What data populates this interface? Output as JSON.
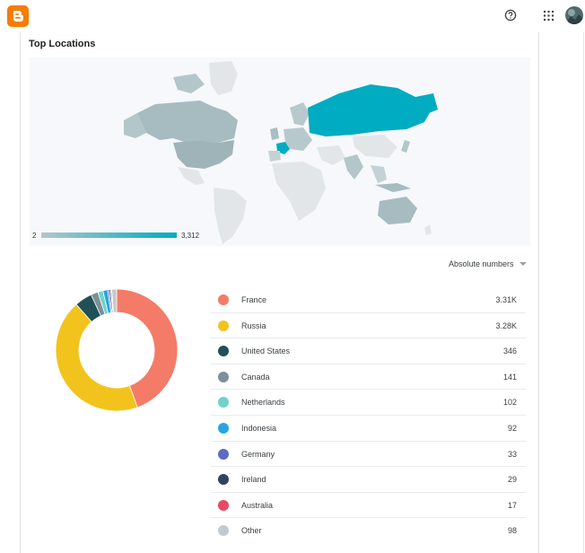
{
  "header": {
    "logo_icon": "blogger-logo-icon",
    "help_icon": "help-circle-icon",
    "apps_icon": "apps-grid-icon",
    "avatar": "user-avatar"
  },
  "section": {
    "title": "Top Locations"
  },
  "map": {
    "legend_min": "2",
    "legend_max": "3,312",
    "color_low": "#b3c6ca",
    "color_high": "#00acc1"
  },
  "view_selector": {
    "label": "Absolute numbers"
  },
  "chart_data": {
    "type": "pie",
    "categories": [
      "France",
      "Russia",
      "United States",
      "Canada",
      "Netherlands",
      "Indonesia",
      "Germany",
      "Ireland",
      "Australia",
      "Other"
    ],
    "values": [
      3310,
      3280,
      346,
      141,
      102,
      92,
      33,
      29,
      17,
      98
    ],
    "colors": [
      "#f47b67",
      "#f2c31c",
      "#1f5157",
      "#7d8f99",
      "#6fd2c9",
      "#27a6e1",
      "#5b6bc6",
      "#34405f",
      "#e94a63",
      "#c4c9cd"
    ]
  },
  "locations": [
    {
      "name": "France",
      "value": "3.31K",
      "color": "#f47b67"
    },
    {
      "name": "Russia",
      "value": "3.28K",
      "color": "#f2c31c"
    },
    {
      "name": "United States",
      "value": "346",
      "color": "#1f5157"
    },
    {
      "name": "Canada",
      "value": "141",
      "color": "#7d8f99"
    },
    {
      "name": "Netherlands",
      "value": "102",
      "color": "#6fd2c9"
    },
    {
      "name": "Indonesia",
      "value": "92",
      "color": "#27a6e1"
    },
    {
      "name": "Germany",
      "value": "33",
      "color": "#5b6bc6"
    },
    {
      "name": "Ireland",
      "value": "29",
      "color": "#34405f"
    },
    {
      "name": "Australia",
      "value": "17",
      "color": "#e94a63"
    },
    {
      "name": "Other",
      "value": "98",
      "color": "#c4c9cd"
    }
  ]
}
